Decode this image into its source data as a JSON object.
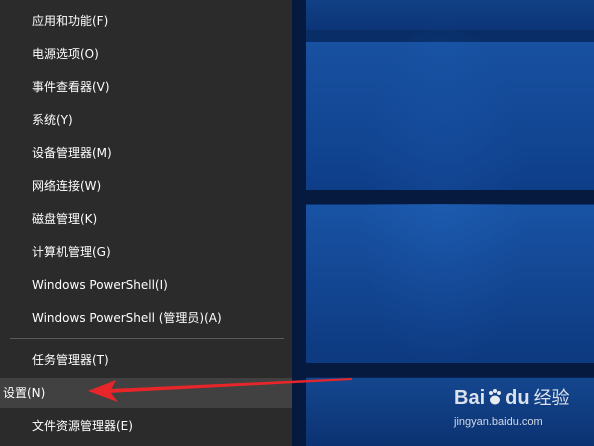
{
  "menu": {
    "items": [
      {
        "label": "应用和功能(F)"
      },
      {
        "label": "电源选项(O)"
      },
      {
        "label": "事件查看器(V)"
      },
      {
        "label": "系统(Y)"
      },
      {
        "label": "设备管理器(M)"
      },
      {
        "label": "网络连接(W)"
      },
      {
        "label": "磁盘管理(K)"
      },
      {
        "label": "计算机管理(G)"
      },
      {
        "label": "Windows PowerShell(I)"
      },
      {
        "label": "Windows PowerShell (管理员)(A)"
      },
      {
        "label": "任务管理器(T)"
      },
      {
        "label": "设置(N)"
      },
      {
        "label": "文件资源管理器(E)"
      }
    ],
    "highlighted": "设置(N)"
  },
  "annotation": {
    "color": "#e8262a"
  },
  "watermark": {
    "logo": "Bai",
    "logo_du": "du",
    "logo_cn": "经验",
    "url": "jingyan.baidu.com"
  }
}
